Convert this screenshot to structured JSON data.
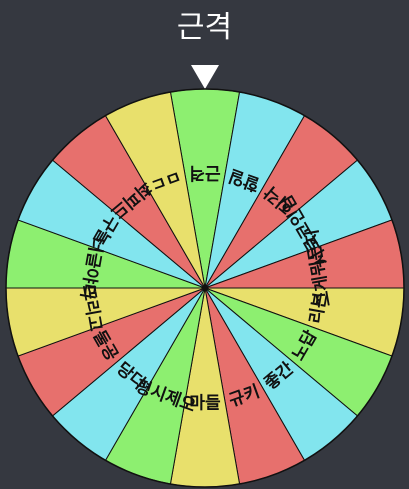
{
  "result_label": "근격",
  "segments": [
    {
      "label": "근격",
      "color": "#8def70"
    },
    {
      "label": "할일",
      "color": "#82e5ee"
    },
    {
      "label": "지각",
      "color": "#e7706d"
    },
    {
      "label": "시로코인임",
      "color": "#82e5ee"
    },
    {
      "label": "그게뭐든지",
      "color": "#e7706d"
    },
    {
      "label": "리본",
      "color": "#e8e06c"
    },
    {
      "label": "노답",
      "color": "#8def70"
    },
    {
      "label": "좋간",
      "color": "#82e5ee"
    },
    {
      "label": "규키",
      "color": "#e7706d"
    },
    {
      "label": "마들",
      "color": "#e8e06c"
    },
    {
      "label": "평시제오",
      "color": "#8def70"
    },
    {
      "label": "당다",
      "color": "#82e5ee"
    },
    {
      "label": "둘공",
      "color": "#e7706d"
    },
    {
      "label": "뜨리고",
      "color": "#e8e06c"
    },
    {
      "label": "너글야디",
      "color": "#8def70"
    },
    {
      "label": "구늘",
      "color": "#82e5ee"
    },
    {
      "label": "최피드",
      "color": "#e7706d"
    },
    {
      "label": "ㅁㄷ",
      "color": "#e8e06c"
    }
  ],
  "pointer": {
    "icon": "triangle-down-icon",
    "color": "#ffffff"
  }
}
